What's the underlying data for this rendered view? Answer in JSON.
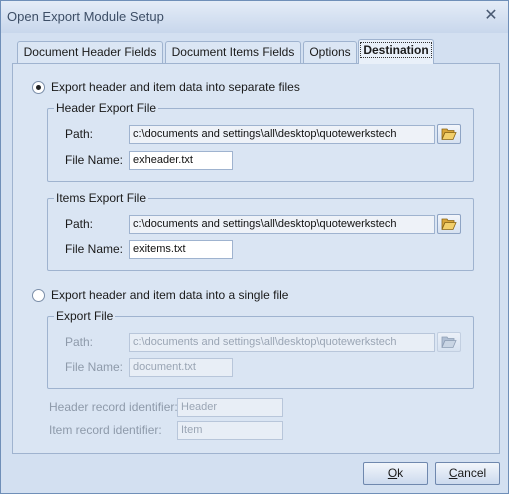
{
  "window": {
    "title": "Open Export Module Setup",
    "close_glyph": "✕"
  },
  "tabs": [
    {
      "label": "Document Header Fields"
    },
    {
      "label": "Document Items Fields"
    },
    {
      "label": "Options"
    },
    {
      "label": "Destination"
    }
  ],
  "active_tab": "Destination",
  "separate": {
    "radio_label": "Export header and item data into separate files",
    "selected": true,
    "header_group": {
      "title": "Header Export File",
      "path_label": "Path:",
      "path_value": "c:\\documents and settings\\all\\desktop\\quotewerkstech",
      "file_label": "File Name:",
      "file_value": "exheader.txt"
    },
    "items_group": {
      "title": "Items Export File",
      "path_label": "Path:",
      "path_value": "c:\\documents and settings\\all\\desktop\\quotewerkstech",
      "file_label": "File Name:",
      "file_value": "exitems.txt"
    }
  },
  "single": {
    "radio_label": "Export header and item data into a single file",
    "selected": false,
    "group": {
      "title": "Export File",
      "path_label": "Path:",
      "path_value": "c:\\documents and settings\\all\\desktop\\quotewerkstech",
      "file_label": "File Name:",
      "file_value": "document.txt"
    },
    "header_id_label": "Header record identifier:",
    "header_id_value": "Header",
    "item_id_label": "Item record identifier:",
    "item_id_value": "Item"
  },
  "buttons": {
    "ok_mnemonic": "O",
    "ok_rest": "k",
    "cancel_mnemonic": "C",
    "cancel_rest": "ancel"
  },
  "icons": {
    "browse": "folder-open-icon"
  },
  "colors": {
    "window_bg": "#d3e0f1",
    "border": "#9fb3cf",
    "folder": "#e8b94a"
  }
}
